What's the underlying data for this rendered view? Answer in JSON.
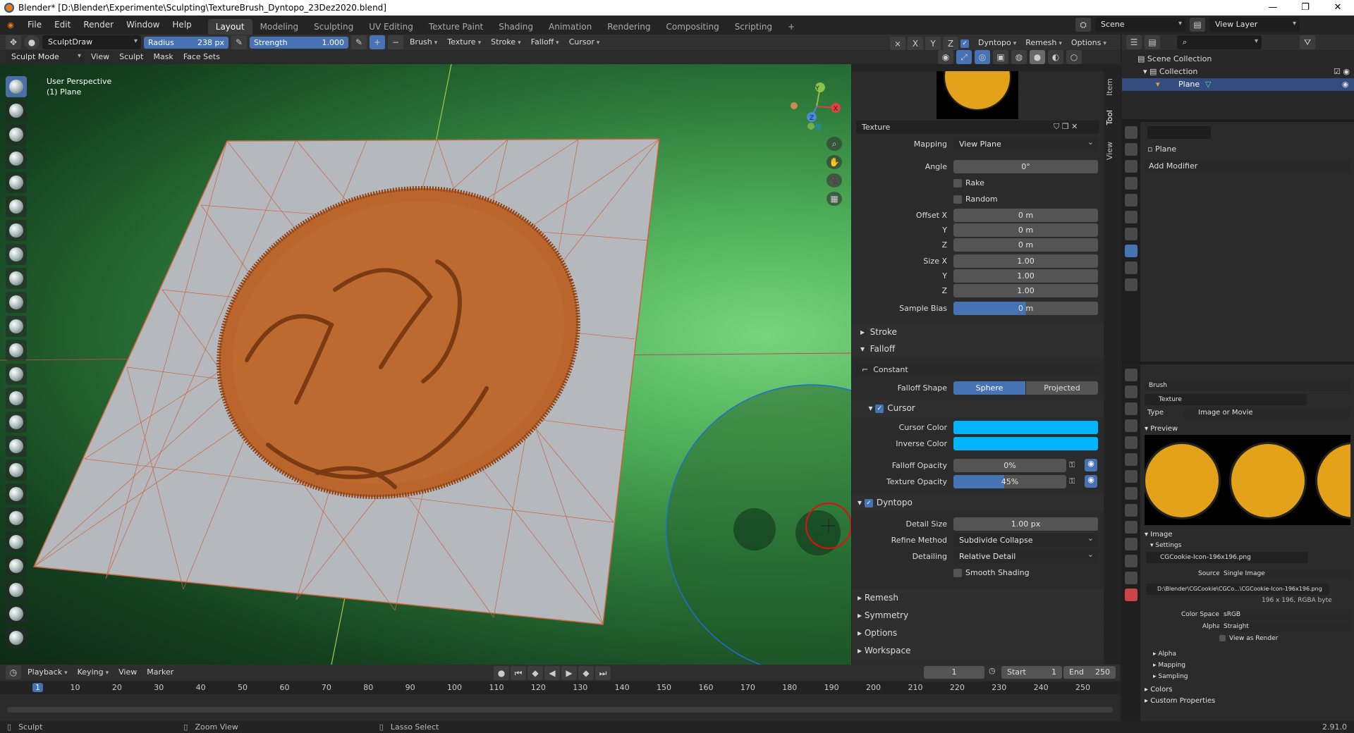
{
  "window": {
    "title": "Blender* [D:\\Blender\\Experimente\\Sculpting\\TextureBrush_Dyntopo_23Dez2020.blend]",
    "minimize": "—",
    "maximize": "❐",
    "close": "✕"
  },
  "menu": [
    "File",
    "Edit",
    "Render",
    "Window",
    "Help"
  ],
  "workspaces": [
    "Layout",
    "Modeling",
    "Sculpting",
    "UV Editing",
    "Texture Paint",
    "Shading",
    "Animation",
    "Rendering",
    "Compositing",
    "Scripting"
  ],
  "topright": {
    "scene": "Scene",
    "view_layer": "View Layer"
  },
  "tool_header": {
    "brush_name": "SculptDraw",
    "radius_label": "Radius",
    "radius_value": "238 px",
    "strength_label": "Strength",
    "strength_value": "1.000",
    "menus": [
      "Brush",
      "Texture",
      "Stroke",
      "Falloff",
      "Cursor"
    ],
    "axes": [
      "X",
      "Y",
      "Z"
    ],
    "dyntopo": "Dyntopo",
    "remesh": "Remesh",
    "options": "Options"
  },
  "viewport_header": {
    "mode": "Sculpt Mode",
    "menus": [
      "View",
      "Sculpt",
      "Mask",
      "Face Sets"
    ]
  },
  "viewport": {
    "perspective": "User Perspective",
    "object": "(1) Plane"
  },
  "gizmo": {
    "x": "X",
    "y": "Y",
    "z": "Z"
  },
  "ntabs": [
    "Item",
    "Tool",
    "View"
  ],
  "tool_panel": {
    "texture_label": "Texture",
    "mapping_label": "Mapping",
    "mapping_value": "View Plane",
    "angle_label": "Angle",
    "angle_value": "0°",
    "rake": "Rake",
    "random": "Random",
    "offset_x_label": "Offset X",
    "offset_x": "0 m",
    "y_label": "Y",
    "offset_y": "0 m",
    "z_label": "Z",
    "offset_z": "0 m",
    "size_x_label": "Size X",
    "size_x": "1.00",
    "size_y": "1.00",
    "size_z": "1.00",
    "sample_bias_label": "Sample Bias",
    "sample_bias": "0 m",
    "stroke": "Stroke",
    "falloff": "Falloff",
    "constant": "Constant",
    "falloff_shape_label": "Falloff Shape",
    "sphere": "Sphere",
    "projected": "Projected",
    "cursor": "Cursor",
    "cursor_color_label": "Cursor Color",
    "inverse_color_label": "Inverse Color",
    "falloff_opacity_label": "Falloff Opacity",
    "falloff_opacity": "0%",
    "texture_opacity_label": "Texture Opacity",
    "texture_opacity": "45%",
    "dyntopo": "Dyntopo",
    "detail_size_label": "Detail Size",
    "detail_size": "1.00 px",
    "refine_method_label": "Refine Method",
    "refine_method": "Subdivide Collapse",
    "detailing_label": "Detailing",
    "detailing": "Relative Detail",
    "smooth_shading": "Smooth Shading",
    "remesh": "Remesh",
    "symmetry": "Symmetry",
    "options": "Options",
    "workspace": "Workspace"
  },
  "outliner": {
    "scene_collection": "Scene Collection",
    "collection": "Collection",
    "plane": "Plane"
  },
  "modifiers": {
    "object": "Plane",
    "add_modifier": "Add Modifier"
  },
  "texture_props": {
    "brush": "Brush",
    "texture": "Texture",
    "type_label": "Type",
    "type_value": "Image or Movie",
    "preview": "Preview",
    "image": "Image",
    "settings": "Settings",
    "image_name": "CGCookie-Icon-196x196.png",
    "source_label": "Source",
    "source_value": "Single Image",
    "path": "D:\\Blender\\CGCookie\\CGCo...\\CGCookie-Icon-196x196.png",
    "resolution": "196 x 196,  RGBA byte",
    "color_space_label": "Color Space",
    "color_space": "sRGB",
    "alpha_label": "Alpha",
    "alpha_value": "Straight",
    "view_as_render": "View as Render",
    "alpha_sub": "Alpha",
    "mapping_sub": "Mapping",
    "sampling_sub": "Sampling",
    "colors": "Colors",
    "custom_properties": "Custom Properties"
  },
  "timeline": {
    "menus": [
      "Playback",
      "Keying",
      "View",
      "Marker"
    ],
    "current_frame": "1",
    "start_label": "Start",
    "start": "1",
    "end_label": "End",
    "end": "250",
    "ticks": [
      "1",
      "10",
      "20",
      "30",
      "40",
      "50",
      "60",
      "70",
      "80",
      "90",
      "100",
      "110",
      "120",
      "130",
      "140",
      "150",
      "160",
      "170",
      "180",
      "190",
      "200",
      "210",
      "220",
      "230",
      "240",
      "250"
    ]
  },
  "status": {
    "left": "Sculpt",
    "middle": "Zoom View",
    "right": "Lasso Select",
    "version": "2.91.0"
  },
  "colors": {
    "accent": "#4772b3",
    "cursor": "#00b4ff",
    "mesh_edge": "#c8643c",
    "disc": "#b9652b"
  }
}
